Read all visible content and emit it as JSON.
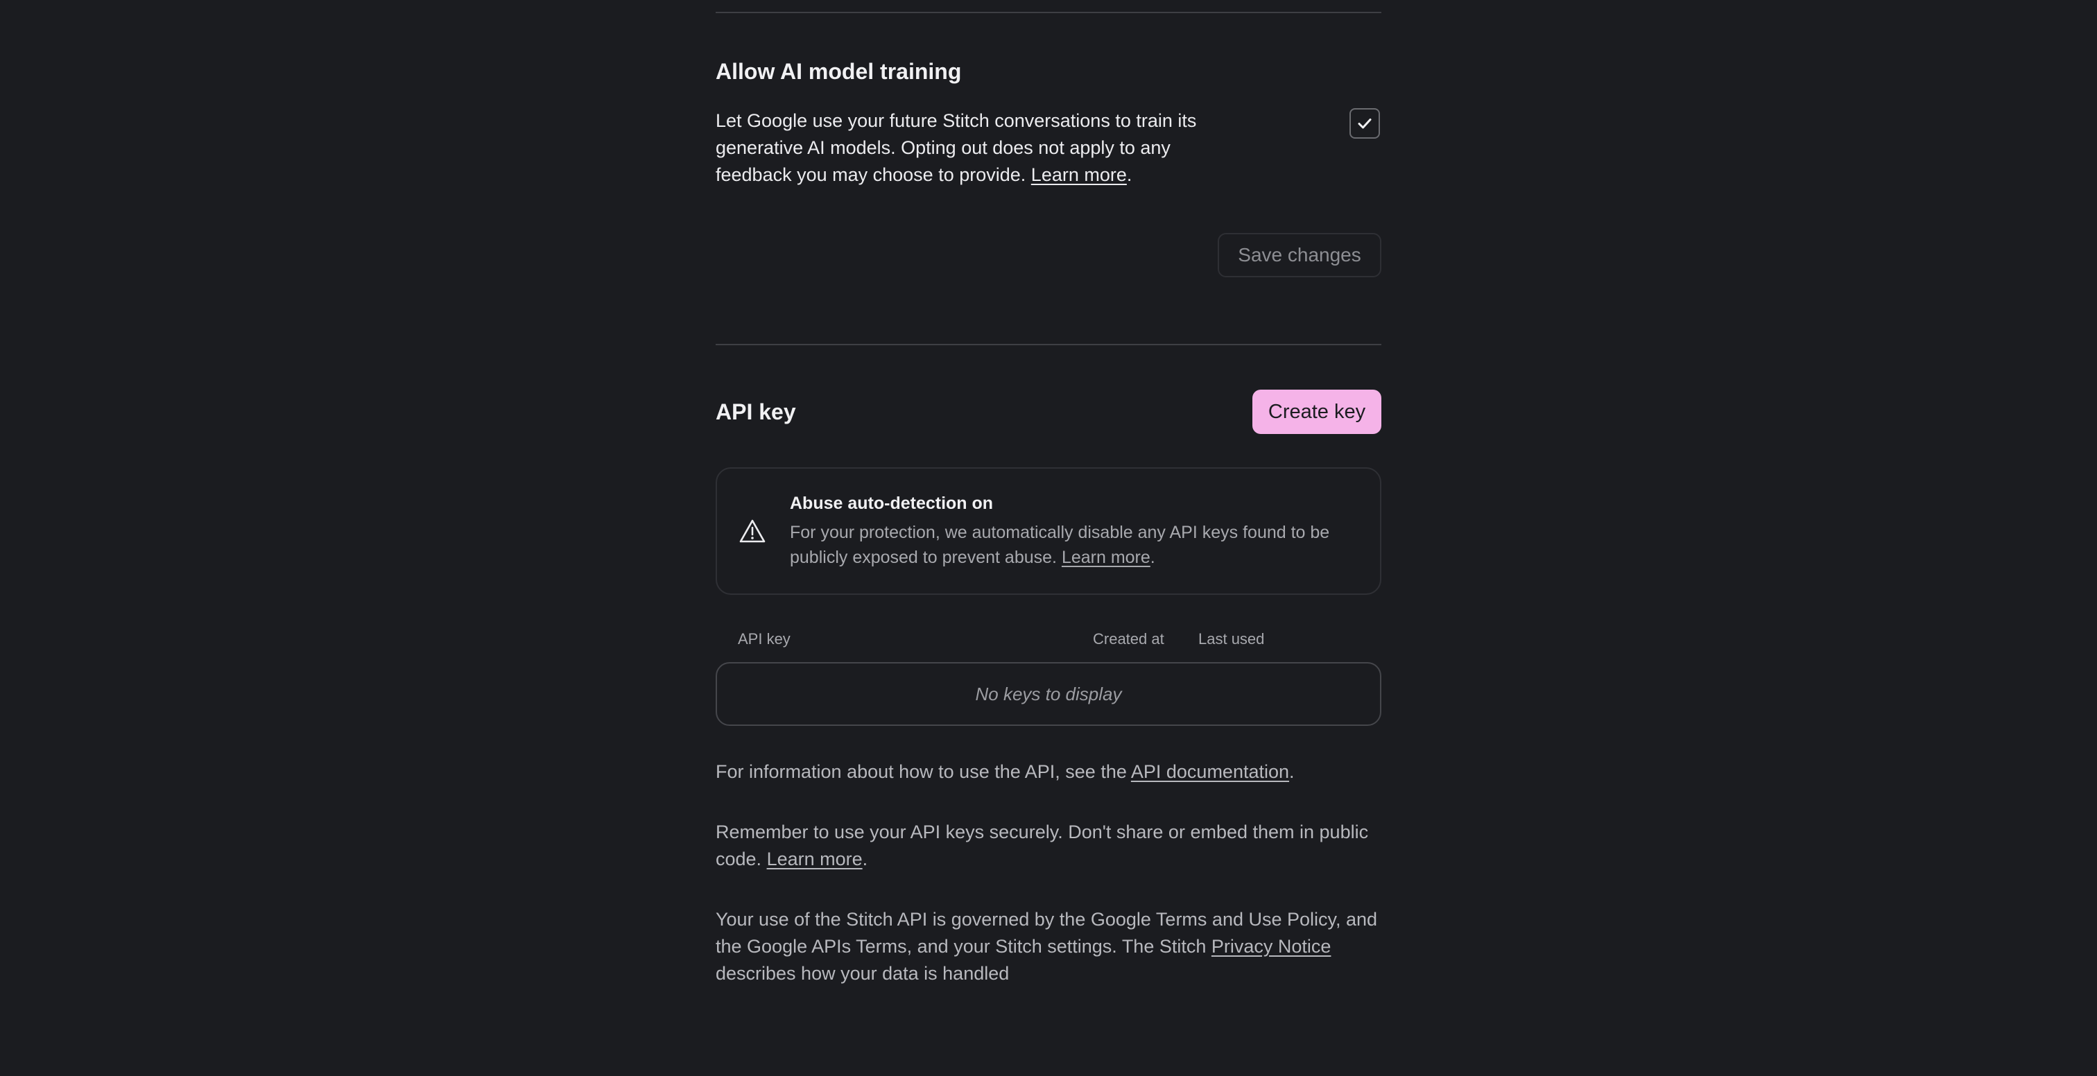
{
  "ai_training": {
    "heading": "Allow AI model training",
    "description": "Let Google use your future Stitch conversations to train its generative AI models. Opting out does not apply to any feedback you may choose to provide.",
    "learn_more": "Learn more",
    "trailing_period": ".",
    "checkbox_checked": true,
    "save_label": "Save changes"
  },
  "api_key": {
    "heading": "API key",
    "create_label": "Create key",
    "notice": {
      "title": "Abuse auto-detection on",
      "body": "For your protection, we automatically disable any API keys found to be publicly exposed to prevent abuse.",
      "learn_more": "Learn more",
      "trailing_period": "."
    },
    "table": {
      "columns": [
        "API key",
        "Created at",
        "Last used"
      ],
      "empty_text": "No keys to display"
    },
    "info": {
      "prefix": "For information about how to use the API, see the",
      "link": "API documentation",
      "suffix": "."
    },
    "security": {
      "text": "Remember to use your API keys securely. Don't share or embed them in public code.",
      "learn_more": "Learn more",
      "suffix": "."
    },
    "terms": {
      "prefix": "Your use of the Stitch API is governed by the Google Terms and Use Policy, and the Google APIs Terms, and your Stitch settings. The Stitch",
      "link": "Privacy Notice",
      "suffix": "describes how your data is handled"
    }
  },
  "colors": {
    "background": "#1b1c20",
    "accent": "#f5b3e8",
    "divider": "#3e3f44"
  }
}
